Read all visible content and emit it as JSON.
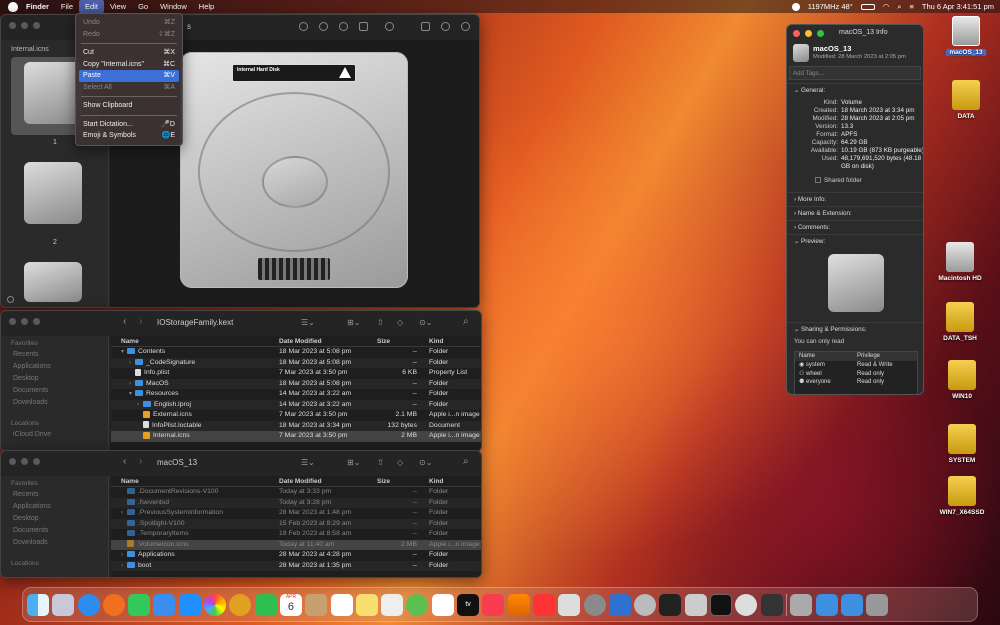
{
  "menubar": {
    "app": "Finder",
    "items": [
      "File",
      "Edit",
      "View",
      "Go",
      "Window",
      "Help"
    ],
    "status": "1197MHz 48°",
    "datetime": "Thu 6 Apr  3:41:51 pm"
  },
  "edit_menu": {
    "undo": "Undo",
    "undo_sc": "⌘Z",
    "redo": "Redo",
    "redo_sc": "⇧⌘Z",
    "cut": "Cut",
    "cut_sc": "⌘X",
    "copy": "Copy \"Internal.icns\"",
    "copy_sc": "⌘C",
    "paste": "Paste",
    "paste_sc": "⌘V",
    "select_all": "Select All",
    "select_all_sc": "⌘A",
    "show_clipboard": "Show Clipboard",
    "start_dictation": "Start Dictation...",
    "start_dictation_sc": "🎤D",
    "emoji": "Emoji & Symbols",
    "emoji_sc": "🌐E"
  },
  "preview_window": {
    "sidebar_title": "Internal.icns",
    "page1": "1",
    "page2": "2",
    "title_fragment": "s",
    "hd_label": "Internal Hard Disk"
  },
  "window1": {
    "path": "IOStorageFamily.kext",
    "columns": [
      "Name",
      "Date Modified",
      "Size",
      "Kind"
    ],
    "sidebar": {
      "favorites": "Favorites",
      "items": [
        "Recents",
        "Applications",
        "Desktop",
        "Documents",
        "Downloads"
      ],
      "locations": "Locations",
      "icloud": "iCloud Drive"
    },
    "rows": [
      {
        "name": "Contents",
        "date": "18 Mar 2023 at 5:08 pm",
        "size": "--",
        "kind": "Folder"
      },
      {
        "name": "_CodeSignature",
        "date": "18 Mar 2023 at 5:08 pm",
        "size": "--",
        "kind": "Folder"
      },
      {
        "name": "Info.plist",
        "date": "7 Mar 2023 at 3:50 pm",
        "size": "6 KB",
        "kind": "Property List"
      },
      {
        "name": "MacOS",
        "date": "18 Mar 2023 at 5:08 pm",
        "size": "--",
        "kind": "Folder"
      },
      {
        "name": "Resources",
        "date": "14 Mar 2023 at 3:22 am",
        "size": "--",
        "kind": "Folder"
      },
      {
        "name": "English.lproj",
        "date": "14 Mar 2023 at 3:22 am",
        "size": "--",
        "kind": "Folder"
      },
      {
        "name": "External.icns",
        "date": "7 Mar 2023 at 3:50 pm",
        "size": "2.1 MB",
        "kind": "Apple i...n image"
      },
      {
        "name": "InfoPlist.loctable",
        "date": "18 Mar 2023 at 3:34 pm",
        "size": "132 bytes",
        "kind": "Document"
      },
      {
        "name": "Internal.icns",
        "date": "7 Mar 2023 at 3:50 pm",
        "size": "2 MB",
        "kind": "Apple i...n image"
      }
    ]
  },
  "window2": {
    "path": "macOS_13",
    "columns": [
      "Name",
      "Date Modified",
      "Size",
      "Kind"
    ],
    "sidebar": {
      "favorites": "Favorites",
      "items": [
        "Recents",
        "Applications",
        "Desktop",
        "Documents",
        "Downloads"
      ],
      "locations": "Locations"
    },
    "rows": [
      {
        "name": ".DocumentRevisions-V100",
        "date": "Today at 3:33 pm",
        "size": "--",
        "kind": "Folder"
      },
      {
        "name": ".fseventsd",
        "date": "Today at 3:28 pm",
        "size": "--",
        "kind": "Folder"
      },
      {
        "name": ".PreviousSystemInformation",
        "date": "28 Mar 2023 at 1:48 pm",
        "size": "--",
        "kind": "Folder"
      },
      {
        "name": ".Spotlight-V100",
        "date": "15 Feb 2023 at 8:29 am",
        "size": "--",
        "kind": "Folder"
      },
      {
        "name": ".TemporaryItems",
        "date": "19 Feb 2023 at 8:58 am",
        "size": "--",
        "kind": "Folder"
      },
      {
        "name": ".VolumeIcon.icns",
        "date": "Today at 11:40 am",
        "size": "2 MB",
        "kind": "Apple i...n image"
      },
      {
        "name": "Applications",
        "date": "28 Mar 2023 at 4:28 pm",
        "size": "--",
        "kind": "Folder"
      },
      {
        "name": "boot",
        "date": "28 Mar 2023 at 1:35 pm",
        "size": "--",
        "kind": "Folder"
      }
    ]
  },
  "info": {
    "title": "macOS_13 Info",
    "name": "macOS_13",
    "modified_short": "Modified: 28 March 2023 at 2:05 pm",
    "tags_placeholder": "Add Tags...",
    "general": "General:",
    "kind_k": "Kind:",
    "kind_v": "Volume",
    "created_k": "Created:",
    "created_v": "18 March 2023 at 3:34 pm",
    "modified_k": "Modified:",
    "modified_v": "28 March 2023 at 2:05 pm",
    "version_k": "Version:",
    "version_v": "13.3",
    "format_k": "Format:",
    "format_v": "APFS",
    "capacity_k": "Capacity:",
    "capacity_v": "64.29 GB",
    "available_k": "Available:",
    "available_v": "10.19 GB (873 KB purgeable)",
    "used_k": "Used:",
    "used_v": "48,179,691,520 bytes (48.18 GB on disk)",
    "shared": "Shared folder",
    "more_info": "More Info:",
    "name_ext": "Name & Extension:",
    "comments": "Comments:",
    "preview": "Preview:",
    "sharing": "Sharing & Permissions:",
    "can_only_read": "You can only read",
    "perm_cols": [
      "Name",
      "Privilege"
    ],
    "perms": [
      {
        "name": "system",
        "priv": "Read & Write"
      },
      {
        "name": "wheel",
        "priv": "Read only"
      },
      {
        "name": "everyone",
        "priv": "Read only"
      }
    ]
  },
  "desktop": {
    "icons": [
      "macOS_13",
      "DATA",
      "Macintosh HD",
      "DATA_TSH",
      "WIN10",
      "SYSTEM",
      "WIN7_X64SSD"
    ]
  },
  "dock": {
    "calendar_month": "APR",
    "calendar_day": "6",
    "tv_label": "tv"
  },
  "colors": {
    "accent": "#3d6fd8",
    "folder": "#3e8fe0",
    "drive_yellow": "#e8b830"
  }
}
